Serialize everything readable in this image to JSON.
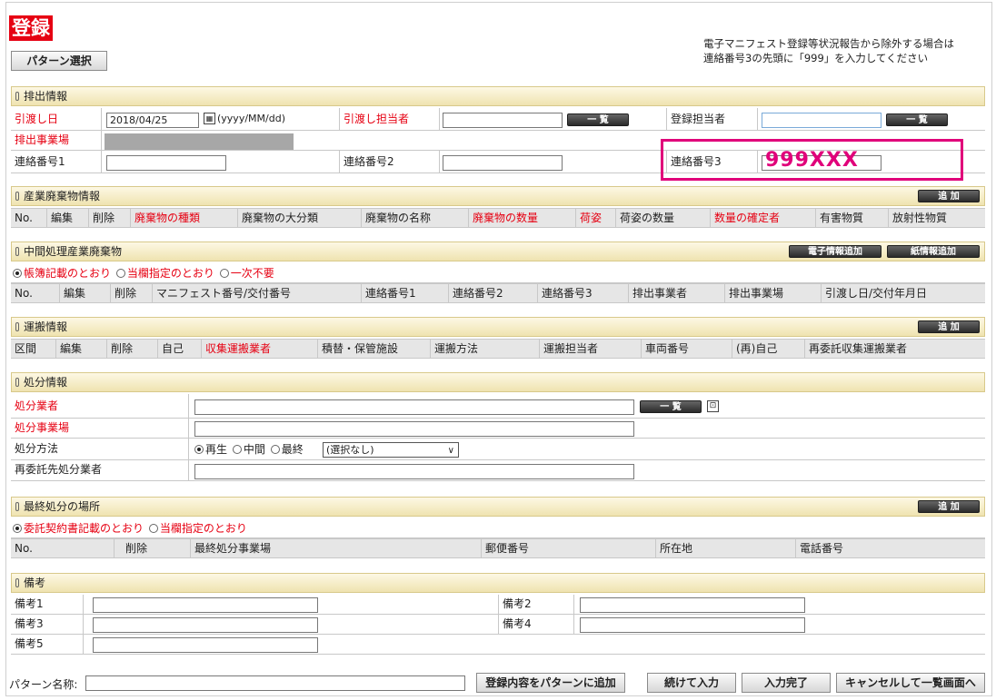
{
  "title": "登録",
  "pattern_select": "パターン選択",
  "note_line1": "電子マニフェスト登録等状況報告から除外する場合は",
  "note_line2": "連絡番号3の先頭に「999」を入力してください",
  "haishutsu": {
    "section": "排出情報",
    "hikiwatashi_label": "引渡し日",
    "date_value": "2018/04/25",
    "date_format": "(yyyy/MM/dd)",
    "tantosha_label": "引渡し担当者",
    "list_btn": "一 覧",
    "touroku_tantosha_label": "登録担当者",
    "jigyoujou_label": "排出事業場",
    "renraku1": "連絡番号1",
    "renraku2": "連絡番号2",
    "renraku3": "連絡番号3",
    "renraku3_value": "999XXX"
  },
  "sangyou": {
    "section": "産業廃棄物情報",
    "add_btn": "追 加",
    "cols": [
      "No.",
      "編集",
      "削除",
      "廃棄物の種類",
      "廃棄物の大分類",
      "廃棄物の名称",
      "廃棄物の数量",
      "荷姿",
      "荷姿の数量",
      "数量の確定者",
      "有害物質",
      "放射性物質"
    ]
  },
  "chukan": {
    "section": "中間処理産業廃棄物",
    "btn_denshi": "電子情報追加",
    "btn_kami": "紙情報追加",
    "radio1": "帳簿記載のとおり",
    "radio2": "当欄指定のとおり",
    "radio3": "一次不要",
    "cols": [
      "No.",
      "編集",
      "削除",
      "マニフェスト番号/交付番号",
      "連絡番号1",
      "連絡番号2",
      "連絡番号3",
      "排出事業者",
      "排出事業場",
      "引渡し日/交付年月日"
    ]
  },
  "unpan": {
    "section": "運搬情報",
    "add_btn": "追 加",
    "cols": [
      "区間",
      "編集",
      "削除",
      "自己",
      "収集運搬業者",
      "積替・保管施設",
      "運搬方法",
      "運搬担当者",
      "車両番号",
      "(再)自己",
      "再委託収集運搬業者"
    ]
  },
  "shobun": {
    "section": "処分情報",
    "gyousha": "処分業者",
    "jigyoujou": "処分事業場",
    "houhou": "処分方法",
    "opt1": "再生",
    "opt2": "中間",
    "opt3": "最終",
    "select_value": "(選択なし)",
    "saiitaku": "再委託先処分業者",
    "list_btn": "一 覧"
  },
  "saishu": {
    "section": "最終処分の場所",
    "add_btn": "追 加",
    "radio1": "委託契約書記載のとおり",
    "radio2": "当欄指定のとおり",
    "cols": [
      "No.",
      "削除",
      "最終処分事業場",
      "郵便番号",
      "所在地",
      "電話番号"
    ]
  },
  "bikou": {
    "section": "備考",
    "b1": "備考1",
    "b2": "備考2",
    "b3": "備考3",
    "b4": "備考4",
    "b5": "備考5"
  },
  "footer": {
    "pattern_name_label": "パターン名称:",
    "btn_add_pattern": "登録内容をパターンに追加",
    "btn_continue": "続けて入力",
    "btn_complete": "入力完了",
    "btn_cancel": "キャンセルして一覧画面へ"
  }
}
